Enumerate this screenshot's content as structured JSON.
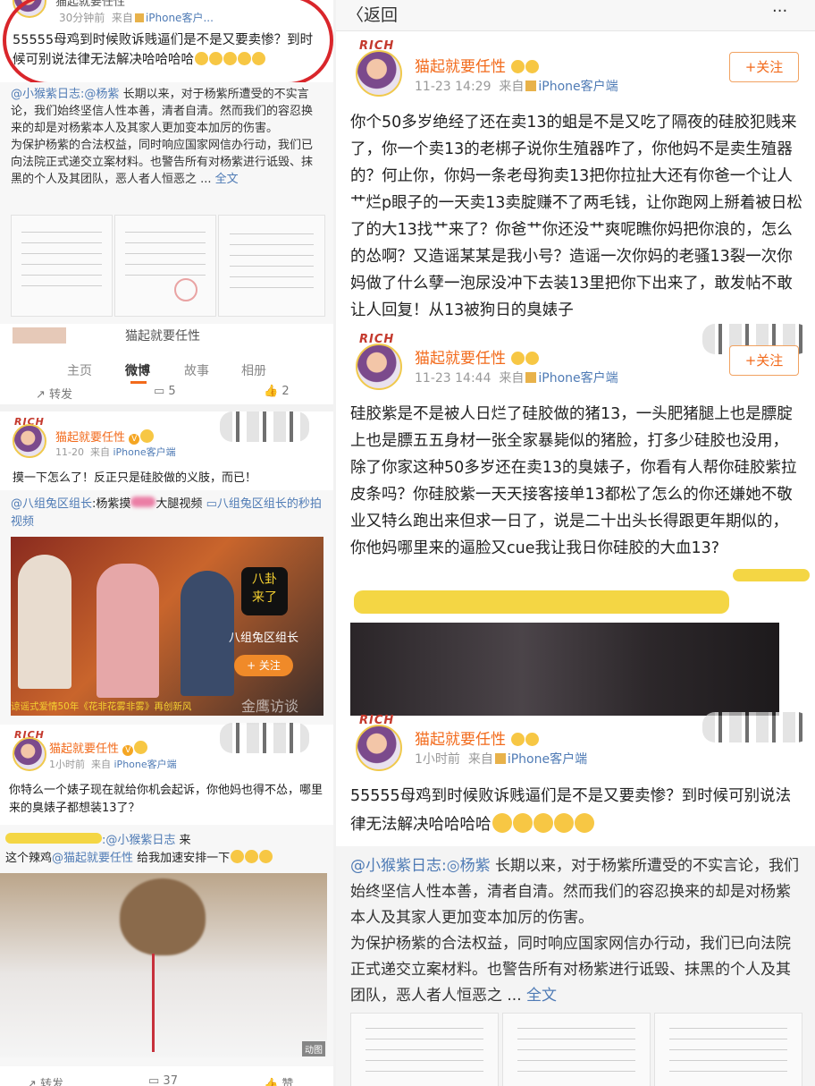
{
  "left": {
    "top_nick": "猫起就要任性",
    "top_time": "30分钟前",
    "top_source_prefix": "来自",
    "top_source": "iPhone客户...",
    "top_post": "55555母鸡到时候败诉贱逼们是不是又要卖惨？到时候可别说法律无法解决哈哈哈哈",
    "repost_user": "@小猴紫日志",
    "repost_mention": "@杨紫",
    "repost_text_1": "长期以来，对于杨紫所遭受的不实言论，我们始终坚信人性本善，清者自清。然而我们的容忍换来的却是对杨紫本人及其家人更加变本加厉的伤害。",
    "repost_text_2": "为保护杨紫的合法权益，同时响应国家网信办行动，我们已向法院正式递交立案材料。也警告所有对杨紫进行诋毁、抹黑的个人及其团队，恶人者人恒恶之 ...",
    "full_text": "全文",
    "profile_name": "猫起就要任性",
    "tabs": [
      "主页",
      "微博",
      "故事",
      "相册"
    ],
    "repost_count_label": "转发",
    "comment_count": "5",
    "like_count": "2",
    "post2_rich": "RICH",
    "post2_nick": "猫起就要任性",
    "post2_time": "11-20",
    "post2_source_prefix": "来自",
    "post2_source": "iPhone客户端",
    "post2_text": "摸一下怎么了！反正只是硅胶做的义肢，而已！",
    "post2_repost_user": "@八组兔区组长",
    "post2_repost_text_a": ":杨紫摸",
    "post2_repost_text_b": "大腿视频",
    "post2_repost_link": "八组兔区组长的秒拍视频",
    "video_badge_top": "八卦",
    "video_badge_bottom": "来了",
    "video_channel": "八组兔区组长",
    "video_follow": "+ 关注",
    "video_caption": "谅谣式爱情50年《花非花雾非雾》再创新风",
    "video_watermark": "金鹰访谈",
    "post3_rich": "RICH",
    "post3_nick": "猫起就要任性",
    "post3_time": "1小时前",
    "post3_source_prefix": "来自",
    "post3_source": "iPhone客户端",
    "post3_text": "你特么一个婊子现在就给你机会起诉，你他妈也得不怂，哪里来的臭婊子都想装13了？",
    "post4_mention": ":@小猴紫日志",
    "post4_come": "来",
    "post4_line2_a": "这个辣鸡",
    "post4_line2_user": "@猫起就要任性",
    "post4_line2_b": "给我加速安排一下",
    "meme_gif": "动图",
    "bottom_repost": "转发",
    "bottom_comment": "37",
    "bottom_like": "赞"
  },
  "right": {
    "back": "返回",
    "more": "···",
    "c1_rich": "RICH",
    "c1_nick": "猫起就要任性",
    "c1_time": "11-23 14:29",
    "c1_source_prefix": "来自",
    "c1_source": "iPhone客户端",
    "c1_follow": "+关注",
    "c1_text": "你个50多岁绝经了还在卖13的蛆是不是又吃了隔夜的硅胶犯贱来了，你一个卖13的老梆子说你生殖器咋了，你他妈不是卖生殖器的？何止你，你妈一条老母狗卖13把你拉扯大还有你爸一个让人艹烂p眼子的一天卖13卖腚赚不了两毛钱，让你跑网上掰着被日松了的大13找艹来了？你爸艹你还没艹爽呢瞧你妈把你浪的，怎么的怂啊？又造谣某某是我小号？造谣一次你妈的老骚13裂一次你妈做了什么孽一泡尿没冲下去装13里把你下出来了，敢发帖不敢让人回复！从13被狗日的臭婊子",
    "c2_rich": "RICH",
    "c2_nick": "猫起就要任性",
    "c2_time": "11-23 14:44",
    "c2_source_prefix": "来自",
    "c2_source": "iPhone客户端",
    "c2_follow": "+关注",
    "c2_text": "硅胶紫是不是被人日烂了硅胶做的猪13，一头肥猪腿上也是膘腚上也是膘五五身材一张全家暴毙似的猪脸，打多少硅胶也没用，除了你家这种50多岁还在卖13的臭婊子，你看有人帮你硅胶紫拉皮条吗？你硅胶紫一天天接客接单13都松了怎么的你还嫌她不敬业又特么跑出来但求一日了，说是二十出头长得跟更年期似的，你他妈哪里来的逼脸又cue我让我日你硅胶的大血13?",
    "c3_rich": "RICH",
    "c3_nick": "猫起就要任性",
    "c3_time": "1小时前",
    "c3_source_prefix": "来自",
    "c3_source": "iPhone客户端",
    "c3_text": "55555母鸡到时候败诉贱逼们是不是又要卖惨？到时候可别说法律无法解决哈哈哈哈",
    "rp_user": "@小猴紫日志",
    "rp_mention": "杨紫",
    "rp_text_1": "长期以来，对于杨紫所遭受的不实言论，我们始终坚信人性本善，清者自清。然而我们的容忍换来的却是对杨紫本人及其家人更加变本加厉的伤害。",
    "rp_text_2": "为保护杨紫的合法权益，同时响应国家网信办行动，我们已向法院正式递交立案材料。也警告所有对杨紫进行诋毁、抹黑的个人及其团队，恶人者人恒恶之 ...",
    "rp_full": "全文"
  }
}
